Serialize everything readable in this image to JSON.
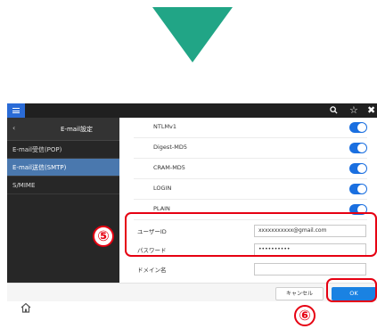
{
  "screen": {
    "sidebar": {
      "back_symbol": "‹",
      "title": "E-mail設定",
      "items": [
        {
          "label": "E-mail受信(POP)"
        },
        {
          "label": "E-mail送信(SMTP)"
        },
        {
          "label": "S/MIME"
        }
      ]
    },
    "auth_methods": [
      {
        "label": "NTLMv1",
        "enabled": true
      },
      {
        "label": "Digest-MD5",
        "enabled": true
      },
      {
        "label": "CRAM-MD5",
        "enabled": true
      },
      {
        "label": "LOGIN",
        "enabled": true
      },
      {
        "label": "PLAIN",
        "enabled": true
      }
    ],
    "fields": {
      "user_id": {
        "label": "ユーザーID",
        "value": "xxxxxxxxxxx@gmail.com"
      },
      "password": {
        "label": "パスワード",
        "value": "••••••••••"
      },
      "domain": {
        "label": "ドメイン名",
        "value": ""
      }
    },
    "footer": {
      "cancel_label": "キャンセル",
      "ok_label": "OK"
    },
    "step_numbers": {
      "fields_step": "⑤",
      "ok_step": "⑥"
    },
    "colors": {
      "arrow": "#21a586",
      "highlight": "#e60012",
      "toggle_on": "#1a6fe0",
      "ok_button": "#1a82e2",
      "active_sidebar": "#4a78ae"
    },
    "icons": [
      "menu-icon",
      "search-icon",
      "star-icon",
      "close-icon",
      "home-icon",
      "back-chevron-icon"
    ]
  }
}
